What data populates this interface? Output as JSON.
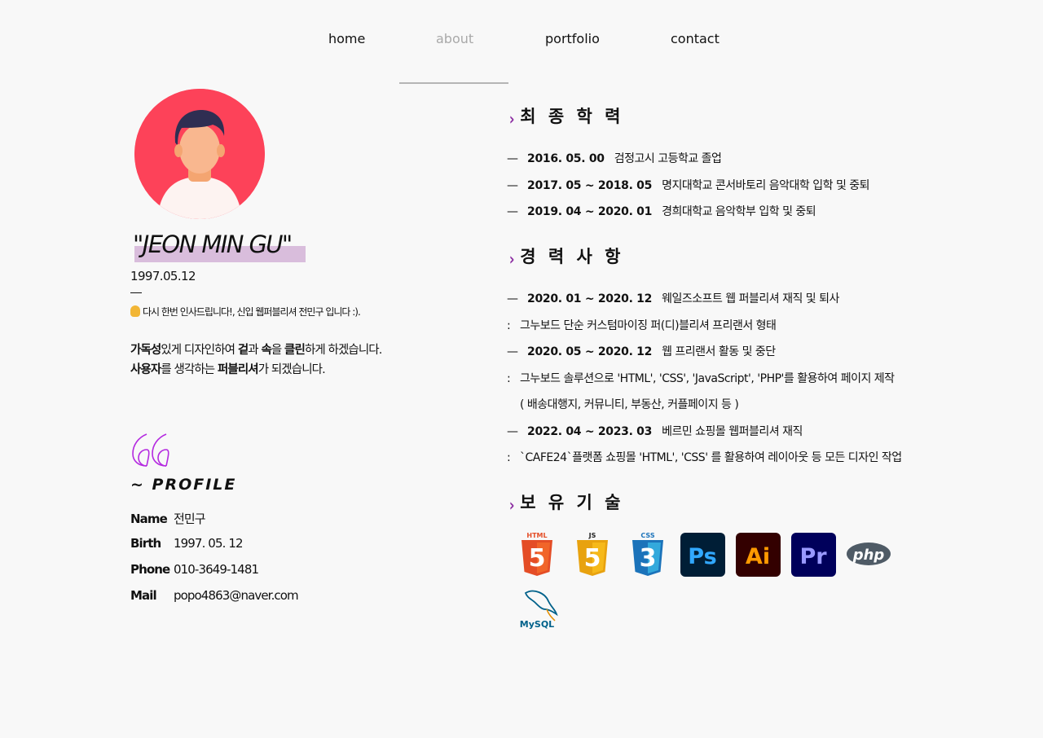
{
  "nav": {
    "items": [
      {
        "label": "home"
      },
      {
        "label": "about"
      },
      {
        "label": "portfolio"
      },
      {
        "label": "contact"
      }
    ],
    "active": "about"
  },
  "profile_card": {
    "name": "\"JEON MIN GU\"",
    "birth": "1997.05.12",
    "greeting": "다시 한번 인사드립니다!, 신입 웹퍼블리셔 전민구 입니다 :).",
    "intro_line1": {
      "parts": [
        {
          "text": "가독성",
          "bold": true
        },
        {
          "text": "있게 디자인하여 ",
          "bold": false
        },
        {
          "text": "겉",
          "bold": true
        },
        {
          "text": "과 ",
          "bold": false
        },
        {
          "text": "속",
          "bold": true
        },
        {
          "text": "을 ",
          "bold": false
        },
        {
          "text": "클린",
          "bold": true
        },
        {
          "text": "하게 하겠습니다.",
          "bold": false
        }
      ]
    },
    "intro_line2": {
      "parts": [
        {
          "text": "사용자",
          "bold": true
        },
        {
          "text": "를 생각하는 ",
          "bold": false
        },
        {
          "text": "퍼블리셔",
          "bold": true
        },
        {
          "text": "가 되겠습니다.",
          "bold": false
        }
      ]
    }
  },
  "profile_section": {
    "title": "~ PROFILE",
    "rows": [
      {
        "key": "Name",
        "value": "전민구"
      },
      {
        "key": "Birth",
        "value": "1997. 05. 12"
      },
      {
        "key": "Phone",
        "value": "010-3649-1481"
      },
      {
        "key": "Mail",
        "value": "popo4863@naver.com"
      }
    ]
  },
  "education": {
    "title": "최 종 학 력",
    "rows": [
      {
        "dash": "—",
        "date": "2016. 05. 00",
        "text": "검정고시 고등학교 졸업"
      },
      {
        "dash": "—",
        "date": "2017. 05 ~ 2018. 05",
        "text": "명지대학교 콘서바토리 음악대학 입학 및 중퇴"
      },
      {
        "dash": "—",
        "date": "2019. 04 ~ 2020. 01",
        "text": "경희대학교 음악학부 입학 및 중퇴"
      }
    ]
  },
  "career": {
    "title": "경 력 사 항",
    "rows": [
      {
        "type": "dash",
        "dash": "—",
        "date": "2020. 01 ~ 2020. 12",
        "text": "웨일즈소프트 웹 퍼블리셔 재직 및 퇴사"
      },
      {
        "type": "colon",
        "colon": ":",
        "text": "그누보드 단순 커스텀마이징 퍼(디)블리셔 프리랜서 형태"
      },
      {
        "type": "dash",
        "dash": "—",
        "date": "2020. 05 ~ 2020. 12",
        "text": "웹 프리랜서 활동 및 중단"
      },
      {
        "type": "colon",
        "colon": ":",
        "text": "그누보드 솔루션으로 'HTML', 'CSS', 'JavaScript', 'PHP'를 활용하여 페이지 제작"
      },
      {
        "type": "indent",
        "text": "( 배송대행지, 커뮤니티, 부동산, 커플페이지 등 )"
      },
      {
        "type": "dash",
        "dash": "—",
        "date": "2022. 04 ~ 2023. 03",
        "text": "베르민 쇼핑몰 웹퍼블리셔 재직"
      },
      {
        "type": "colon",
        "colon": ":",
        "text": "`CAFE24`플랫폼 쇼핑몰 'HTML', 'CSS' 를 활용하여 레이아웃 등 모든 디자인 작업"
      }
    ]
  },
  "skills": {
    "title": "보 유 기 술",
    "items": [
      {
        "name": "html5-icon",
        "label": "HTML",
        "badge": "5",
        "color": "#e44d26"
      },
      {
        "name": "js-icon",
        "label": "JS",
        "badge": "5",
        "color": "#f0a818"
      },
      {
        "name": "css3-icon",
        "label": "CSS",
        "badge": "3",
        "color": "#1b73ba"
      },
      {
        "name": "photoshop-icon",
        "label": "Ps",
        "color": "#31a8ff",
        "bg": "#001e36"
      },
      {
        "name": "illustrator-icon",
        "label": "Ai",
        "color": "#ff9a00",
        "bg": "#330000"
      },
      {
        "name": "premiere-icon",
        "label": "Pr",
        "color": "#9999ff",
        "bg": "#00005b"
      },
      {
        "name": "php-icon",
        "label": "php",
        "color": "#ffffff",
        "bg": "#4f5b66"
      },
      {
        "name": "mysql-icon",
        "label": "MySQL",
        "color": "#00618a"
      }
    ]
  },
  "colors": {
    "accent": "#8a2aa0",
    "name_highlight": "#d9bddc",
    "avatar_bg": "#fd4259",
    "active_nav": "#a9a9a9"
  }
}
